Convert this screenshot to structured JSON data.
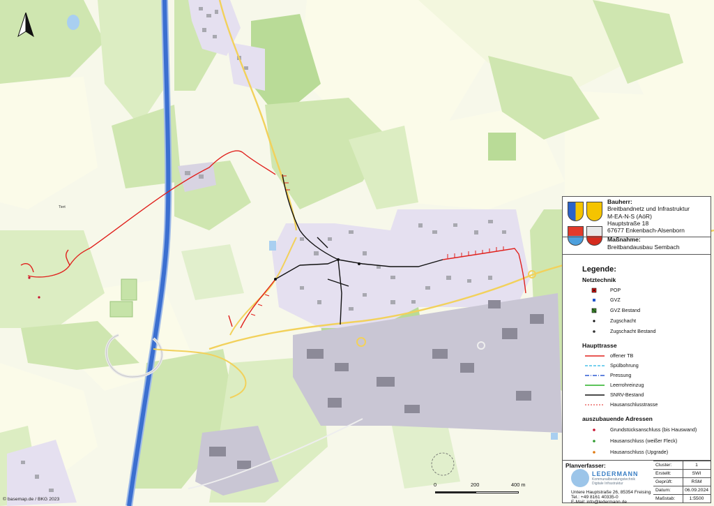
{
  "map": {
    "attribution": "© basemap.de / BKG 2023",
    "north_arrow": "north-arrow-icon",
    "scale_bar": {
      "ticks": [
        "0",
        "200",
        "400 m"
      ]
    },
    "place_labels": [
      "Tiert"
    ]
  },
  "header": {
    "bauherr_label": "Bauherr:",
    "bauherr_lines": [
      "Breitbandnetz und Infrastruktur",
      "M-EA-N-S (AöR)",
      "Hauptstraße 18",
      "67677 Enkenbach-Alsenborn"
    ],
    "massnahme_label": "Maßnahme:",
    "massnahme_value": "Breitbandausbau Sembach"
  },
  "legend": {
    "title": "Legende:",
    "sections": [
      {
        "title": "Netztechnik",
        "items": [
          {
            "label": "POP",
            "icon": "pop-icon",
            "color": "#cc1111"
          },
          {
            "label": "GVZ",
            "icon": "gvz-icon",
            "color": "#2255cc"
          },
          {
            "label": "GVZ Bestand",
            "icon": "gvz-bestand-icon",
            "color": "#3a8a2a"
          },
          {
            "label": "Zugschacht",
            "icon": "zugschacht-icon",
            "color": "#111111"
          },
          {
            "label": "Zugschacht Bestand",
            "icon": "zugschacht-bestand-icon",
            "color": "#333333"
          }
        ]
      },
      {
        "title": "Haupttrasse",
        "items": [
          {
            "label": "offener TB",
            "icon": "line-offener-tb",
            "color": "#e0201c"
          },
          {
            "label": "Spülbohrung",
            "icon": "line-spuelbohrung",
            "color": "#49c0e8"
          },
          {
            "label": "Pressung",
            "icon": "line-pressung",
            "color": "#2d5ad2"
          },
          {
            "label": "Leerrohreinzug",
            "icon": "line-leerrohreinzug",
            "color": "#27b023"
          },
          {
            "label": "SNRV-Bestand",
            "icon": "line-snrv-bestand",
            "color": "#111111"
          },
          {
            "label": "Hausanschlusstrasse",
            "icon": "line-hausanschlusstrasse",
            "color": "#e0201c"
          }
        ]
      },
      {
        "title": "auszubauende Adressen",
        "items": [
          {
            "label": "Grundstücksanschluss (bis Hauswand)",
            "icon": "point-grundstueck",
            "color": "#c8102e"
          },
          {
            "label": "Hausanschluss (weißer Fleck)",
            "icon": "point-weisser-fleck",
            "color": "#2e9a2e"
          },
          {
            "label": "Hausanschluss (Upgrade)",
            "icon": "point-upgrade",
            "color": "#e07a10"
          }
        ]
      }
    ]
  },
  "footer": {
    "planverfasser_label": "Planverfasser:",
    "company": "LEDERMANN",
    "company_sub_1": "Kommunalberatungstechnik",
    "company_sub_2": "Digitale Infrastruktur",
    "address_lines": [
      "Untere Hauptstraße 26, 85354 Freising",
      "Tel.: +49 8161 40335-0",
      "E-Mail: info@ledermann.de"
    ],
    "meta": [
      {
        "key": "Cluster:",
        "value": "1"
      },
      {
        "key": "Erstellt:",
        "value": "SWI"
      },
      {
        "key": "Geprüft:",
        "value": "RSM"
      },
      {
        "key": "Datum:",
        "value": "06.09.2024"
      },
      {
        "key": "Maßstab:",
        "value": "1:5500"
      }
    ]
  },
  "colors": {
    "meadow": "#eaf3d6",
    "field": "#fbfbe9",
    "forest": "#cfe6b0",
    "forest_dark": "#b9db97",
    "settlement": "#e5e0f0",
    "industry": "#c9c6d4",
    "building": "#9a9a9a",
    "motorway": "#3b6fd0",
    "main_road": "#f2d15b",
    "trench_red": "#e0201c",
    "snrv_black": "#111111"
  }
}
